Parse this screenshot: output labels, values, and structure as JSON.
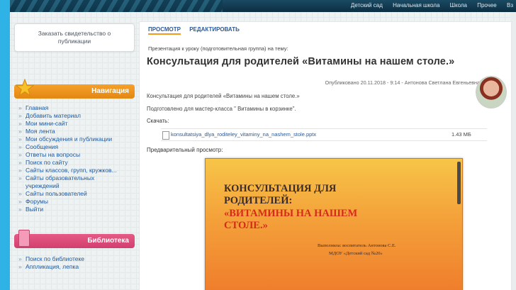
{
  "topnav": {
    "links": [
      "Детский сад",
      "Начальная школа",
      "Школа",
      "Прочее",
      "Вз"
    ]
  },
  "sidebar": {
    "order_cert": "Заказать свидетельство о публикации",
    "nav_title": "Навигация",
    "nav_items": [
      "Главная",
      "Добавить материал",
      "Мои мини-сайт",
      "Моя лента",
      "Мои обсуждения и публикации",
      "Сообщения",
      "Ответы на вопросы",
      "Поиск по сайту",
      "Сайты классов, групп, кружков...",
      "Сайты образовательных учреждений",
      "Сайты пользователей",
      "Форумы",
      "Выйти"
    ],
    "library_title": "Библиотека",
    "library_items": [
      "Поиск по библиотеке",
      "Аппликация, лепка"
    ]
  },
  "main": {
    "tabs": [
      "ПРОСМОТР",
      "РЕДАКТИРОВАТЬ"
    ],
    "breadcrumb": "Презентация к уроку (подготовительная группа) на тему:",
    "title": "Консультация для родителей «Витамины на нашем столе.»",
    "published": "Опубликовано 20.11.2018 - 9:14 - Антонова Светлана Евгеньевна",
    "line1": "Консультация для родителей «Витамины на нашем столе.»",
    "line2": "Подготовлено для мастер-класса \" Витамины в корзинке\".",
    "download_label": "Скачать:",
    "file_name": "konsultatsiya_dlya_roditeley_vitaminy_na_nashem_stole.pptx",
    "file_size": "1.43 МБ",
    "preview_label": "Предварительный просмотр:"
  },
  "slide": {
    "title1": "КОНСУЛЬТАЦИЯ ДЛЯ РОДИТЕЛЕЙ:",
    "title2": "«ВИТАМИНЫ НА НАШЕМ СТОЛЕ.»",
    "author1": "Выполнила: воспитатель Антонова С.Е.",
    "author2": "МДОУ «Детский сад №20»"
  },
  "colors": {
    "accent_orange": "#f39a1e",
    "library_pink": "#d13f6e",
    "link_blue": "#1c5aa3"
  }
}
